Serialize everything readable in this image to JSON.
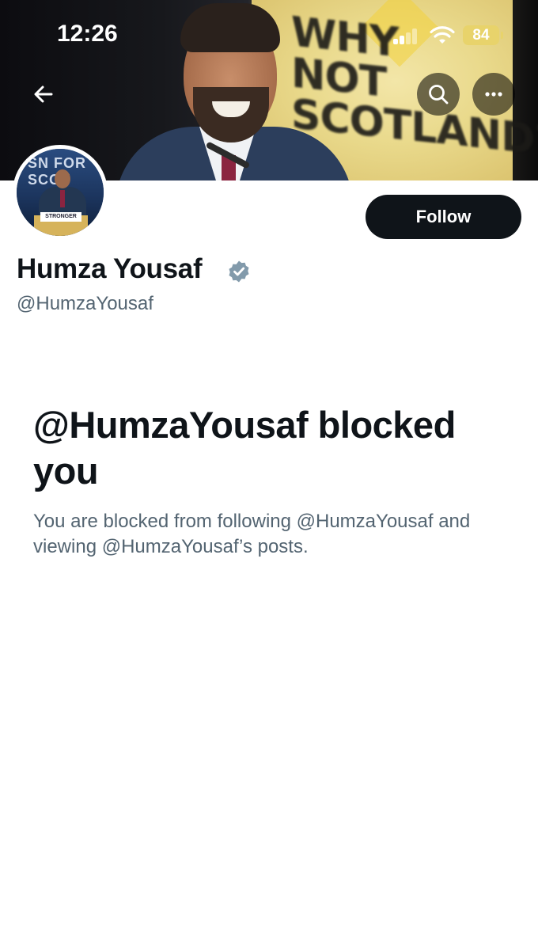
{
  "status_bar": {
    "time": "12:26",
    "battery": "84"
  },
  "header": {
    "banner_text": "WHY NOT SCOTLAND?",
    "back_icon": "arrow-left-icon",
    "search_icon": "search-icon",
    "more_icon": "more-horizontal-icon"
  },
  "profile": {
    "avatar_text": "STRONGER",
    "display_name": "Humza Yousaf",
    "handle": "@HumzaYousaf",
    "follow_label": "Follow",
    "verified_icon": "verified-badge-icon"
  },
  "blocked": {
    "title": "@HumzaYousaf blocked you",
    "description": "You are blocked from following @HumzaYousaf and viewing @HumzaYousaf’s posts."
  },
  "colors": {
    "text_primary": "#0f1419",
    "text_secondary": "#536471",
    "button_bg": "#0f1419",
    "verified": "#829aab"
  }
}
